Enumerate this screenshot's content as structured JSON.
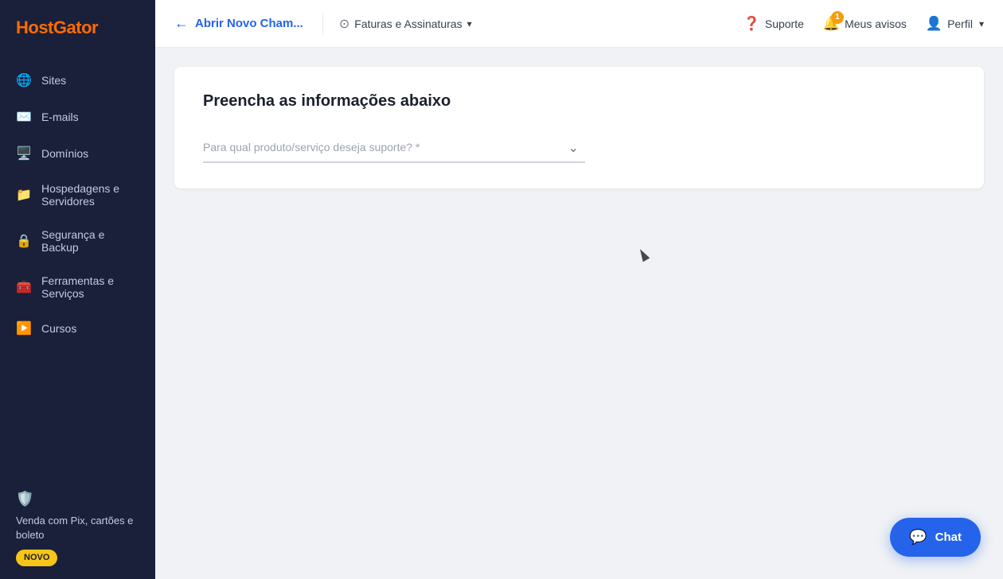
{
  "brand": {
    "name_part1": "Host",
    "name_part2": "Gator"
  },
  "sidebar": {
    "items": [
      {
        "id": "sites",
        "label": "Sites",
        "icon": "🌐"
      },
      {
        "id": "emails",
        "label": "E-mails",
        "icon": "✉️"
      },
      {
        "id": "dominios",
        "label": "Domínios",
        "icon": "🖥️"
      },
      {
        "id": "hospedagens",
        "label": "Hospedagens e Servidores",
        "icon": "📁"
      },
      {
        "id": "seguranca",
        "label": "Segurança e Backup",
        "icon": "🔒"
      },
      {
        "id": "ferramentas",
        "label": "Ferramentas e Serviços",
        "icon": "🧰"
      },
      {
        "id": "cursos",
        "label": "Cursos",
        "icon": "▶️"
      }
    ],
    "promo": {
      "text": "Venda com Pix, cartões e boleto",
      "badge": "NOVO"
    }
  },
  "header": {
    "back_label": "Abrir Novo Cham...",
    "faturas_label": "Faturas e Assinaturas",
    "suporte_label": "Suporte",
    "avisos_label": "Meus avisos",
    "avisos_count": "1",
    "perfil_label": "Perfil"
  },
  "main": {
    "title": "Preencha as informações abaixo",
    "select_placeholder": "Para qual produto/serviço deseja suporte? *"
  },
  "chat": {
    "label": "Chat"
  }
}
